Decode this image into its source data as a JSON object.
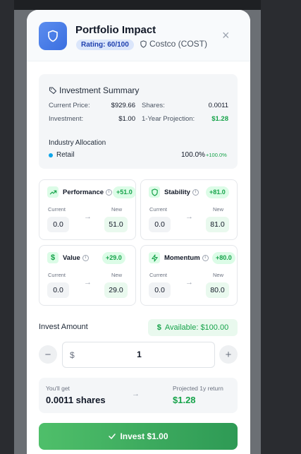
{
  "header": {
    "title": "Portfolio Impact",
    "rating": "Rating: 60/100",
    "ticker": "Costco (COST)",
    "close_glyph": "×"
  },
  "summary": {
    "title": "Investment Summary",
    "current_price_label": "Current Price:",
    "current_price": "$929.66",
    "shares_label": "Shares:",
    "shares": "0.0011",
    "investment_label": "Investment:",
    "investment": "$1.00",
    "projection_label": "1-Year Projection:",
    "projection": "$1.28",
    "industry_title": "Industry Allocation",
    "industry_name": "Retail",
    "industry_pct": "100.0%",
    "industry_delta": "+100.0%",
    "industry_dot_color": "#0ea5e9"
  },
  "metrics": [
    {
      "name": "Performance",
      "icon": "trending-up-icon",
      "badge": "+51.0",
      "current_label": "Current",
      "new_label": "New",
      "current": "0.0",
      "new": "51.0"
    },
    {
      "name": "Stability",
      "icon": "shield-icon",
      "badge": "+81.0",
      "current_label": "Current",
      "new_label": "New",
      "current": "0.0",
      "new": "81.0"
    },
    {
      "name": "Value",
      "icon": "dollar-icon",
      "badge": "+29.0",
      "current_label": "Current",
      "new_label": "New",
      "current": "0.0",
      "new": "29.0"
    },
    {
      "name": "Momentum",
      "icon": "lightning-icon",
      "badge": "+80.0",
      "current_label": "Current",
      "new_label": "New",
      "current": "0.0",
      "new": "80.0"
    }
  ],
  "invest": {
    "label": "Invest Amount",
    "available": "Available: $100.00",
    "currency": "$",
    "amount": "1",
    "minus": "−",
    "plus": "+"
  },
  "result": {
    "you_get_label": "You'll get",
    "you_get": "0.0011 shares",
    "projected_label": "Projected 1y return",
    "projected": "$1.28"
  },
  "cta": {
    "label": "Invest $1.00"
  },
  "colors": {
    "accent": "#3b6fe0",
    "green": "#16a34a"
  }
}
